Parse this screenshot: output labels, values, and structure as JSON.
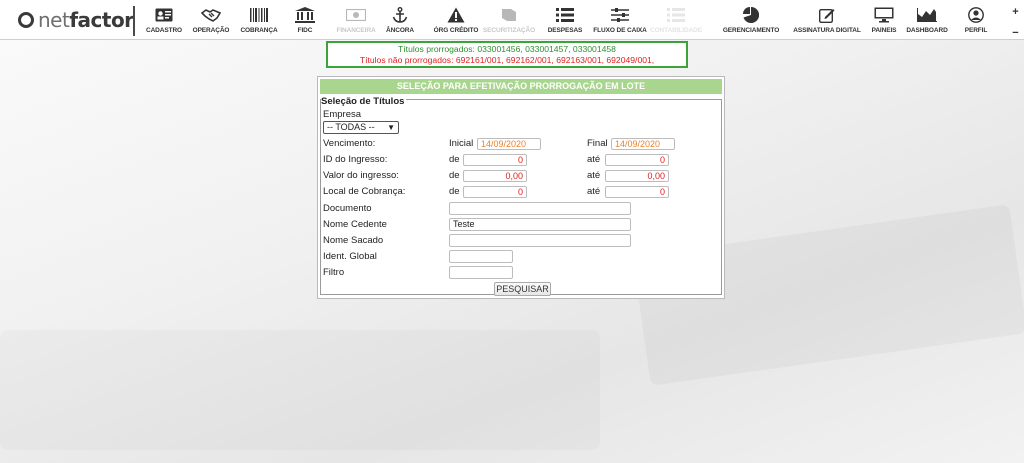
{
  "app": {
    "logo_o": "O",
    "logo_net": "net",
    "logo_factor": "factor"
  },
  "nav": [
    {
      "id": "cadastro",
      "label": "CADASTRO",
      "icon": "id-card-icon",
      "state": "normal"
    },
    {
      "id": "operacao",
      "label": "OPERAÇÃO",
      "icon": "handshake-icon",
      "state": "normal"
    },
    {
      "id": "cobranca",
      "label": "COBRANÇA",
      "icon": "barcode-icon",
      "state": "normal"
    },
    {
      "id": "fidc",
      "label": "FIDC",
      "icon": "bank-icon",
      "state": "normal"
    },
    {
      "id": "financeira",
      "label": "FINANCEIRA",
      "icon": "money-icon",
      "state": "disabled"
    },
    {
      "id": "ancora",
      "label": "ÂNCORA",
      "icon": "anchor-icon",
      "state": "normal"
    },
    {
      "id": "org_credito",
      "label": "ÓRG CRÉDITO",
      "icon": "warning-icon",
      "state": "normal"
    },
    {
      "id": "securitizacao",
      "label": "SECURITIZAÇÃO",
      "icon": "book-icon",
      "state": "disabled"
    },
    {
      "id": "despesas",
      "label": "DESPESAS",
      "icon": "list-icon",
      "state": "normal"
    },
    {
      "id": "fluxo_caixa",
      "label": "FLUXO DE CAIXA",
      "icon": "sliders-icon",
      "state": "normal"
    },
    {
      "id": "contabilidade",
      "label": "CONTABILIDADE",
      "icon": "list-icon",
      "state": "active"
    },
    {
      "id": "gerenciamento",
      "label": "GERENCIAMENTO",
      "icon": "pie-chart-icon",
      "state": "normal"
    },
    {
      "id": "assinatura",
      "label": "ASSINATURA DIGITAL",
      "icon": "pen-icon",
      "state": "normal"
    },
    {
      "id": "paineis",
      "label": "PAINEIS",
      "icon": "monitor-icon",
      "state": "normal"
    },
    {
      "id": "dashboard",
      "label": "DASHBOARD",
      "icon": "area-chart-icon",
      "state": "normal"
    },
    {
      "id": "perfil",
      "label": "PERFIL",
      "icon": "user-circle-icon",
      "state": "normal"
    }
  ],
  "side_controls": {
    "expand": "+",
    "collapse": "−"
  },
  "message": {
    "ok_line": "Títulos prorrogados: 033001456, 033001457, 033001458",
    "bad_line": "Títulos não prorrogados: 692161/001, 692162/001, 692163/001, 692049/001,"
  },
  "panel": {
    "title": "SELEÇÃO PARA EFETIVAÇÃO PRORROGAÇÃO EM LOTE",
    "legend": "Seleção de Títulos",
    "empresa_label": "Empresa",
    "empresa_value": "-- TODAS --",
    "vencimento_label": "Vencimento:",
    "inicial_label": "Inicial",
    "inicial_value": "14/09/2020",
    "final_label": "Final",
    "final_value": "14/09/2020",
    "id_label": "ID do Ingresso:",
    "valor_label": "Valor do ingresso:",
    "local_label": "Local de Cobrança:",
    "de_label": "de",
    "ate_label": "até",
    "id_de": "0",
    "id_ate": "0",
    "valor_de": "0,00",
    "valor_ate": "0,00",
    "local_de": "0",
    "local_ate": "0",
    "documento_label": "Documento",
    "documento_value": "",
    "cedente_label": "Nome Cedente",
    "cedente_value": "Teste",
    "sacado_label": "Nome Sacado",
    "sacado_value": "",
    "ident_label": "Ident. Global",
    "ident_value": "",
    "filtro_label": "Filtro",
    "filtro_value": "",
    "pesquisar_label": "PESQUISAR"
  },
  "colors": {
    "panel_header": "#a8d68e",
    "message_border": "#3aa33a",
    "ok_text": "#2f8f2f",
    "bad_text": "#e02020",
    "date_text": "#e8842f"
  }
}
